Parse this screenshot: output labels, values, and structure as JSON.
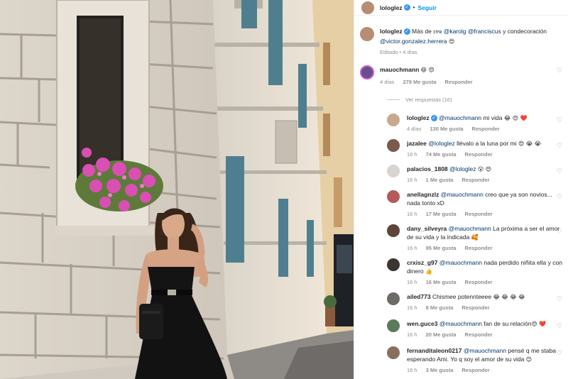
{
  "header": {
    "username": "lologlez",
    "separator": "•",
    "follow_label": "Seguir"
  },
  "caption": {
    "username": "lologlez",
    "text_prefix": "Más de ",
    "brand": "ɪᴛғʀ",
    "mentions": [
      "@karolg",
      "@franciscus",
      "@victor.gonzalez.herrera"
    ],
    "text_mid": " y condecoración",
    "emoji": "😍",
    "meta": "Editado • 4 días"
  },
  "top_comment": {
    "username": "mauochmann",
    "emoji": "😆 😍",
    "time": "4 días",
    "likes": "279 Me gusta",
    "reply": "Responder",
    "view_replies": "Ver respuestas (16)"
  },
  "replies": [
    {
      "username": "lologlez",
      "verified": true,
      "mention": "@mauochmann",
      "text": " mi vida ",
      "emoji": "😂 😍 ❤️",
      "time": "4 días",
      "likes": "130 Me gusta",
      "reply": "Responder",
      "avatar": "#c9a98e"
    },
    {
      "username": "jazalee",
      "verified": false,
      "mention": "@lologlez",
      "text": " llévalo a la luna por mi ",
      "emoji": "😍 😭 😭",
      "time": "16 h",
      "likes": "74 Me gusta",
      "reply": "Responder",
      "avatar": "#7b5a4b"
    },
    {
      "username": "palacios_1808",
      "verified": false,
      "mention": "@lologlez",
      "text": " ",
      "emoji": "😮 😍",
      "time": "16 h",
      "likes": "1 Me gusta",
      "reply": "Responder",
      "avatar": "#d8d4d0"
    },
    {
      "username": "anellagnzlz",
      "verified": false,
      "mention": "@mauochmann",
      "text": " creo que ya son novios... nada tonto xD",
      "emoji": "",
      "time": "16 h",
      "likes": "17 Me gusta",
      "reply": "Responder",
      "avatar": "#b45a5a"
    },
    {
      "username": "dany_silveyra",
      "verified": false,
      "mention": "@mauochmann",
      "text": " La próxima a ser el amor de su vida y la indicada ",
      "emoji": "🥰",
      "time": "16 h",
      "likes": "95 Me gusta",
      "reply": "Responder",
      "avatar": "#5c4638"
    },
    {
      "username": "crxisz_g97",
      "verified": false,
      "mention": "@mauochmann",
      "text": " nada perdido niñita ella y con dinero ",
      "emoji": "👍",
      "time": "16 h",
      "likes": "16 Me gusta",
      "reply": "Responder",
      "avatar": "#3b3531"
    },
    {
      "username": "ailed773",
      "verified": false,
      "mention": "",
      "text": "Chismee potennteeee ",
      "emoji": "😂 😂 😂 😂",
      "time": "16 h",
      "likes": "8 Me gusta",
      "reply": "Responder",
      "avatar": "#6e6a66"
    },
    {
      "username": "wen.guce3",
      "verified": false,
      "mention": "@mauochmann",
      "text": " fan de su relación",
      "emoji": "😍 ❤️",
      "time": "16 h",
      "likes": "20 Me gusta",
      "reply": "Responder",
      "avatar": "#5a7a5a"
    },
    {
      "username": "fernanditaleon0217",
      "verified": false,
      "mention": "@mauochmann",
      "text": " pensé q me staba esperando Ami. Yo q soy el amor de su vida ",
      "emoji": "😊",
      "time": "16 h",
      "likes": "3 Me gusta",
      "reply": "Responder",
      "avatar": "#8a6e5c"
    }
  ],
  "colors": {
    "link": "#00376b",
    "follow": "#0095f6",
    "muted": "#8e8e8e",
    "text": "#262626"
  },
  "icons": {
    "verified": "verified-badge-icon",
    "like": "heart-icon"
  }
}
